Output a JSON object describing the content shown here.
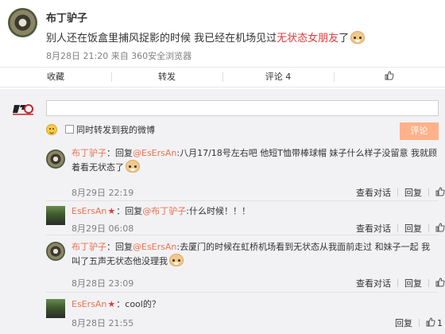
{
  "post": {
    "author": "布丁驴子",
    "text_part1": "别人还在饭盒里捕风捉影的时候 我已经在机场见过",
    "text_highlight": "无状态女朋友",
    "text_part2": "了",
    "meta": "8月28日 21:20 来自 360安全浏览器"
  },
  "actions": {
    "favorite": "收藏",
    "repost": "转发",
    "comment": "评论 4",
    "like_icon": "thumbs-up-icon"
  },
  "composer": {
    "input_placeholder": "",
    "also_repost_label": "同时转发到我的微博",
    "submit_label": "评论"
  },
  "comments": [
    {
      "user": "布丁驴子",
      "text_prefix": "：回复",
      "mention": "@EsErsAn",
      "text": ":八月17/18号左右吧 他短T恤带棒球帽 妹子什么样子没留意 我就顾着看无状态了",
      "date": "8月29日 22:19",
      "view_label": "查看对话",
      "reply_label": "回复",
      "likes": ""
    },
    {
      "user": "EsErsAn",
      "text_prefix": "：回复",
      "mention": "@布丁驴子",
      "text": ":什么时候！！！",
      "date": "8月29日 06:08",
      "view_label": "查看对话",
      "reply_label": "回复",
      "likes": ""
    },
    {
      "user": "布丁驴子",
      "text_prefix": "：回复",
      "mention": "@EsErsAn",
      "text": ":去厦门的时候在虹桥机场看到无状态从我面前走过 和妹子一起 我叫了五声无状态他没理我",
      "date": "8月28日 23:09",
      "view_label": "查看对话",
      "reply_label": "回复",
      "likes": ""
    },
    {
      "user": "EsErsAn",
      "text_prefix": "：",
      "mention": "",
      "text": "cool的？",
      "date": "8月28日 21:55",
      "view_label": "",
      "reply_label": "回复",
      "likes": "1"
    }
  ]
}
